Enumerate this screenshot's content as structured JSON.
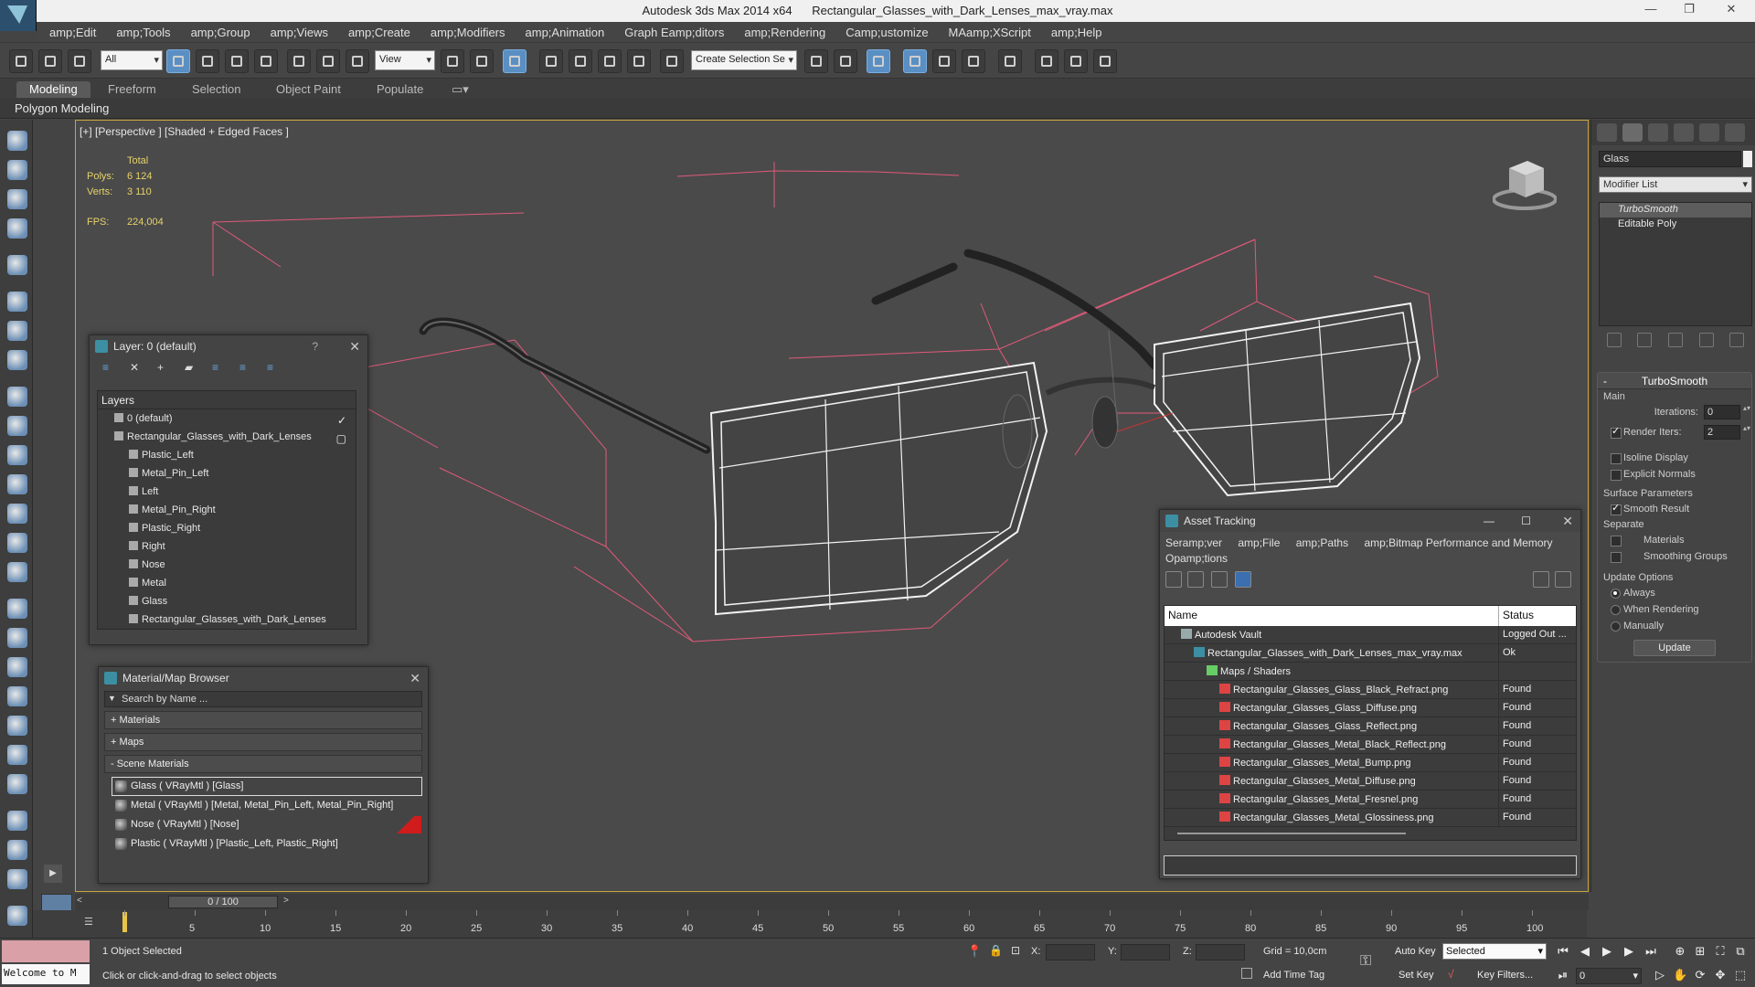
{
  "window": {
    "app_title": "Autodesk 3ds Max  2014 x64",
    "file_title": "Rectangular_Glasses_with_Dark_Lenses_max_vray.max"
  },
  "menu": [
    "amp;Edit",
    "amp;Tools",
    "amp;Group",
    "amp;Views",
    "amp;Create",
    "amp;Modifiers",
    "amp;Animation",
    "Graph Eamp;ditors",
    "amp;Rendering",
    "Camp;ustomize",
    "MAamp;XScript",
    "amp;Help"
  ],
  "toolbar": {
    "filter_select": "All",
    "refcoord_select": "View",
    "selection_set": "Create Selection Se"
  },
  "ribbon": {
    "tabs": [
      "Modeling",
      "Freeform",
      "Selection",
      "Object Paint",
      "Populate"
    ],
    "active_tab": "Modeling",
    "sub_label": "Polygon Modeling"
  },
  "viewport": {
    "label": "[+] [Perspective ] [Shaded + Edged Faces ]",
    "stats": {
      "total_label": "Total",
      "polys_label": "Polys:",
      "polys_value": "6 124",
      "verts_label": "Verts:",
      "verts_value": "3 110",
      "fps_label": "FPS:",
      "fps_value": "224,004"
    }
  },
  "layer_dialog": {
    "title": "Layer: 0 (default)",
    "help": "?",
    "header": "Layers",
    "rows": [
      {
        "label": "0 (default)",
        "indent": 1,
        "mark": "✓"
      },
      {
        "label": "Rectangular_Glasses_with_Dark_Lenses",
        "indent": 1,
        "mark": "▢"
      },
      {
        "label": "Plastic_Left",
        "indent": 2
      },
      {
        "label": "Metal_Pin_Left",
        "indent": 2
      },
      {
        "label": "Left",
        "indent": 2
      },
      {
        "label": "Metal_Pin_Right",
        "indent": 2
      },
      {
        "label": "Plastic_Right",
        "indent": 2
      },
      {
        "label": "Right",
        "indent": 2
      },
      {
        "label": "Nose",
        "indent": 2
      },
      {
        "label": "Metal",
        "indent": 2
      },
      {
        "label": "Glass",
        "indent": 2
      },
      {
        "label": "Rectangular_Glasses_with_Dark_Lenses",
        "indent": 2
      }
    ]
  },
  "material_browser": {
    "title": "Material/Map Browser",
    "search_placeholder": "Search by Name ...",
    "categories": [
      "+ Materials",
      "+ Maps",
      "- Scene Materials"
    ],
    "materials": [
      "Glass  ( VRayMtl ) [Glass]",
      "Metal  ( VRayMtl ) [Metal, Metal_Pin_Left, Metal_Pin_Right]",
      "Nose  ( VRayMtl ) [Nose]",
      "Plastic  ( VRayMtl ) [Plastic_Left, Plastic_Right]"
    ]
  },
  "asset_tracking": {
    "title": "Asset Tracking",
    "menu": [
      "Seramp;ver",
      "amp;File",
      "amp;Paths",
      "amp;Bitmap Performance and Memory",
      "Opamp;tions"
    ],
    "columns": [
      "Name",
      "Status"
    ],
    "rows": [
      {
        "name": "Autodesk Vault",
        "status": "Logged Out ...",
        "indent": 1,
        "icon": "vault-icon"
      },
      {
        "name": "Rectangular_Glasses_with_Dark_Lenses_max_vray.max",
        "status": "Ok",
        "indent": 2,
        "icon": "max-file-icon"
      },
      {
        "name": "Maps / Shaders",
        "status": "",
        "indent": 3,
        "icon": "maps-folder-icon"
      },
      {
        "name": "Rectangular_Glasses_Glass_Black_Refract.png",
        "status": "Found",
        "indent": 4,
        "icon": "png-icon"
      },
      {
        "name": "Rectangular_Glasses_Glass_Diffuse.png",
        "status": "Found",
        "indent": 4,
        "icon": "png-icon"
      },
      {
        "name": "Rectangular_Glasses_Glass_Reflect.png",
        "status": "Found",
        "indent": 4,
        "icon": "png-icon"
      },
      {
        "name": "Rectangular_Glasses_Metal_Black_Reflect.png",
        "status": "Found",
        "indent": 4,
        "icon": "png-icon"
      },
      {
        "name": "Rectangular_Glasses_Metal_Bump.png",
        "status": "Found",
        "indent": 4,
        "icon": "png-icon"
      },
      {
        "name": "Rectangular_Glasses_Metal_Diffuse.png",
        "status": "Found",
        "indent": 4,
        "icon": "png-icon"
      },
      {
        "name": "Rectangular_Glasses_Metal_Fresnel.png",
        "status": "Found",
        "indent": 4,
        "icon": "png-icon"
      },
      {
        "name": "Rectangular_Glasses_Metal_Glossiness.png",
        "status": "Found",
        "indent": 4,
        "icon": "png-icon"
      }
    ]
  },
  "command_panel": {
    "object_name": "Glass",
    "modifier_list": "Modifier List",
    "stack": [
      "TurboSmooth",
      "Editable Poly"
    ],
    "turbosmooth": {
      "title": "TurboSmooth",
      "main": "Main",
      "iterations_label": "Iterations:",
      "iterations_value": "0",
      "render_iters_label": "Render Iters:",
      "render_iters_value": "2",
      "isoline": "Isoline Display",
      "explicit": "Explicit Normals",
      "surface": "Surface Parameters",
      "smooth_result": "Smooth Result",
      "separate": "Separate",
      "materials": "Materials",
      "smoothing_groups": "Smoothing Groups",
      "update_options": "Update Options",
      "always": "Always",
      "when_rendering": "When Rendering",
      "manually": "Manually",
      "update": "Update"
    }
  },
  "timeline": {
    "slider": "0 / 100",
    "ticks": [
      "0",
      "5",
      "10",
      "15",
      "20",
      "25",
      "30",
      "35",
      "40",
      "45",
      "50",
      "55",
      "60",
      "65",
      "70",
      "75",
      "80",
      "85",
      "90",
      "95",
      "100"
    ]
  },
  "status": {
    "maxscript": "Welcome to M",
    "selected": "1 Object Selected",
    "hint": "Click or click-and-drag to select objects",
    "x_label": "X:",
    "y_label": "Y:",
    "z_label": "Z:",
    "grid": "Grid = 10,0cm",
    "add_time_tag": "Add Time Tag",
    "auto_key": "Auto Key",
    "set_key": "Set Key",
    "selected_drop": "Selected",
    "key_filters": "Key Filters...",
    "frame_value": "0"
  },
  "colors": {
    "viewport_border": "#c8a53c",
    "stats_text": "#e8d36a",
    "bbox_lines": "#e05a7a",
    "active_blue": "#5a8fc4"
  }
}
